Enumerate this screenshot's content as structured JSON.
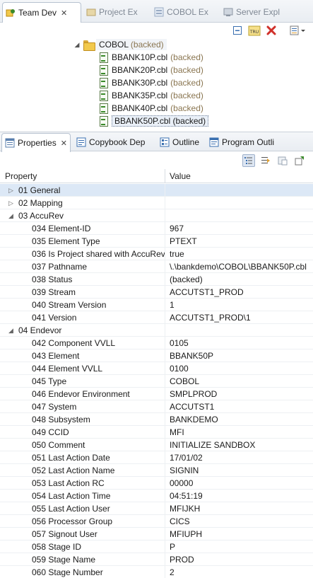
{
  "top_view": {
    "tabs": [
      {
        "label": "Team Dev",
        "close": "✕"
      },
      {
        "label": "Project Ex"
      },
      {
        "label": "COBOL Ex"
      },
      {
        "label": "Server Expl"
      }
    ],
    "toolbar": {
      "collapse_icon": "collapse-all-icon",
      "tru_icon": "tru-icon",
      "tru_text": "TRU",
      "delete_icon": "delete-icon",
      "menu_icon": "view-menu-icon"
    },
    "tree": {
      "root": {
        "label": "COBOL",
        "status": "(backed)"
      },
      "children": [
        {
          "label": "BBANK10P.cbl",
          "status": "(backed)"
        },
        {
          "label": "BBANK20P.cbl",
          "status": "(backed)"
        },
        {
          "label": "BBANK30P.cbl",
          "status": "(backed)"
        },
        {
          "label": "BBANK35P.cbl",
          "status": "(backed)"
        },
        {
          "label": "BBANK40P.cbl",
          "status": "(backed)"
        },
        {
          "label": "BBANK50P.cbl (backed)"
        }
      ]
    }
  },
  "properties_view": {
    "tabs": [
      {
        "label": "Properties",
        "close": "✕"
      },
      {
        "label": "Copybook Dep"
      },
      {
        "label": "Outline"
      },
      {
        "label": "Program Outli"
      }
    ],
    "toolbar_icons": [
      "categories-icon",
      "advanced-icon",
      "restore-default-icon",
      "pin-icon"
    ],
    "columns": {
      "property": "Property",
      "value": "Value"
    },
    "rows": [
      {
        "type": "cat",
        "expand": "▷",
        "label": "01 General",
        "value": ""
      },
      {
        "type": "cat",
        "expand": "▷",
        "label": "02 Mapping",
        "value": ""
      },
      {
        "type": "cat",
        "expand": "◢",
        "label": "03 AccuRev",
        "value": ""
      },
      {
        "type": "item",
        "label": "034 Element-ID",
        "value": "967"
      },
      {
        "type": "item",
        "label": "035 Element Type",
        "value": "PTEXT"
      },
      {
        "type": "item",
        "label": "036 Is Project shared with AccuRev",
        "value": "true"
      },
      {
        "type": "item",
        "label": "037 Pathname",
        "value": "\\.\\bankdemo\\COBOL\\BBANK50P.cbl"
      },
      {
        "type": "item",
        "label": "038 Status",
        "value": "(backed)"
      },
      {
        "type": "item",
        "label": "039 Stream",
        "value": "ACCUTST1_PROD"
      },
      {
        "type": "item",
        "label": "040 Stream Version",
        "value": "1"
      },
      {
        "type": "item",
        "label": "041 Version",
        "value": "ACCUTST1_PROD\\1"
      },
      {
        "type": "cat",
        "expand": "◢",
        "label": "04 Endevor",
        "value": ""
      },
      {
        "type": "item",
        "label": "042 Component VVLL",
        "value": "0105"
      },
      {
        "type": "item",
        "label": "043 Element",
        "value": "BBANK50P"
      },
      {
        "type": "item",
        "label": "044 Element VVLL",
        "value": "0100"
      },
      {
        "type": "item",
        "label": "045 Type",
        "value": "COBOL"
      },
      {
        "type": "item",
        "label": "046 Endevor Environment",
        "value": "SMPLPROD"
      },
      {
        "type": "item",
        "label": "047 System",
        "value": "ACCUTST1"
      },
      {
        "type": "item",
        "label": "048 Subsystem",
        "value": "BANKDEMO"
      },
      {
        "type": "item",
        "label": "049 CCID",
        "value": "MFI"
      },
      {
        "type": "item",
        "label": "050 Comment",
        "value": "INITIALIZE SANDBOX"
      },
      {
        "type": "item",
        "label": "051 Last Action Date",
        "value": "17/01/02"
      },
      {
        "type": "item",
        "label": "052 Last Action Name",
        "value": "SIGNIN"
      },
      {
        "type": "item",
        "label": "053 Last Action RC",
        "value": "00000"
      },
      {
        "type": "item",
        "label": "054 Last Action Time",
        "value": "04:51:19"
      },
      {
        "type": "item",
        "label": "055 Last Action User",
        "value": "MFIJKH"
      },
      {
        "type": "item",
        "label": "056 Processor Group",
        "value": "CICS"
      },
      {
        "type": "item",
        "label": "057 Signout User",
        "value": "MFIUPH"
      },
      {
        "type": "item",
        "label": "058 Stage ID",
        "value": "P"
      },
      {
        "type": "item",
        "label": "059 Stage Name",
        "value": "PROD"
      },
      {
        "type": "item",
        "label": "060 Stage Number",
        "value": "2"
      }
    ]
  },
  "colors": {
    "accent": "#3a6fb0",
    "backed_text": "#8a7651",
    "delete_red": "#d0302a",
    "selection": "#dce8f6"
  }
}
